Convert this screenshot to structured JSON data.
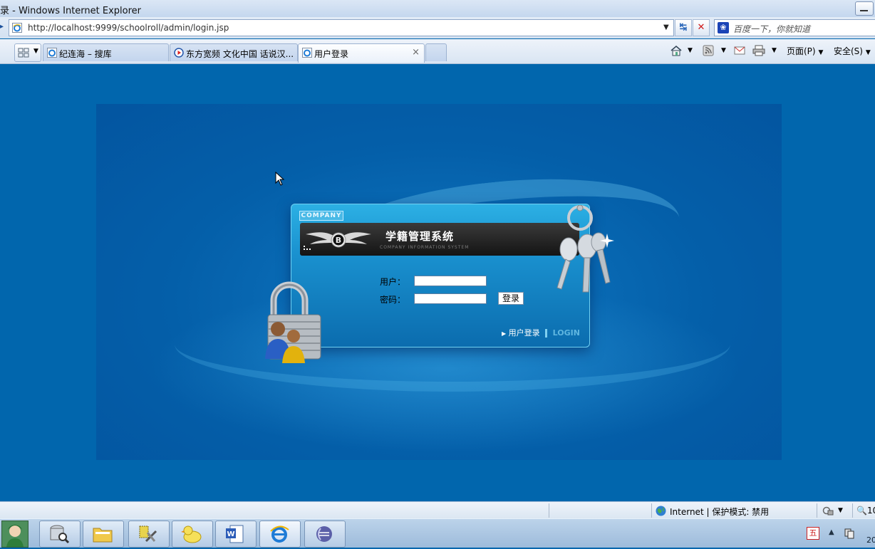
{
  "window": {
    "title": "录 - Windows Internet Explorer"
  },
  "address_bar": {
    "url": "http://localhost:9999/schoolroll/admin/login.jsp"
  },
  "search": {
    "placeholder": "百度一下，你就知道",
    "provider_icon": "baidu-paw-icon"
  },
  "tabs": [
    {
      "label": "纪连海 – 搜库",
      "icon": "ie-page-icon",
      "active": false
    },
    {
      "label": "东方宽频 文化中国 话说汉...",
      "icon": "media-play-icon",
      "active": false
    },
    {
      "label": "用户登录",
      "icon": "ie-page-icon",
      "active": true,
      "close": "×"
    }
  ],
  "command_bar": {
    "page_menu": "页面(P)",
    "safety_menu": "安全(S)"
  },
  "login": {
    "company_badge": "COMPANY",
    "system_title": "学籍管理系统",
    "system_subtitle": "COMPANY INFORMATION SYSTEM",
    "username_label": "用户：",
    "password_label": "密码：",
    "login_button": "登录",
    "footer_link": "用户登录",
    "footer_en": "LOGIN",
    "logo": "winged-b-logo"
  },
  "status_bar": {
    "zone_text": "Internet | 保护模式: 禁用",
    "zoom_text": "10"
  },
  "taskbar": {
    "apps": [
      "user-avatar-icon",
      "database-search-icon",
      "folder-icon",
      "tools-icon",
      "duck-icon",
      "word-icon",
      "internet-explorer-icon",
      "eclipse-icon"
    ],
    "tray_input": "五",
    "clock_partial": "20"
  },
  "colors": {
    "page_bg": "#0166ad",
    "box_accent": "#2cb0e4",
    "banner_bg": "#1a1a1a"
  }
}
